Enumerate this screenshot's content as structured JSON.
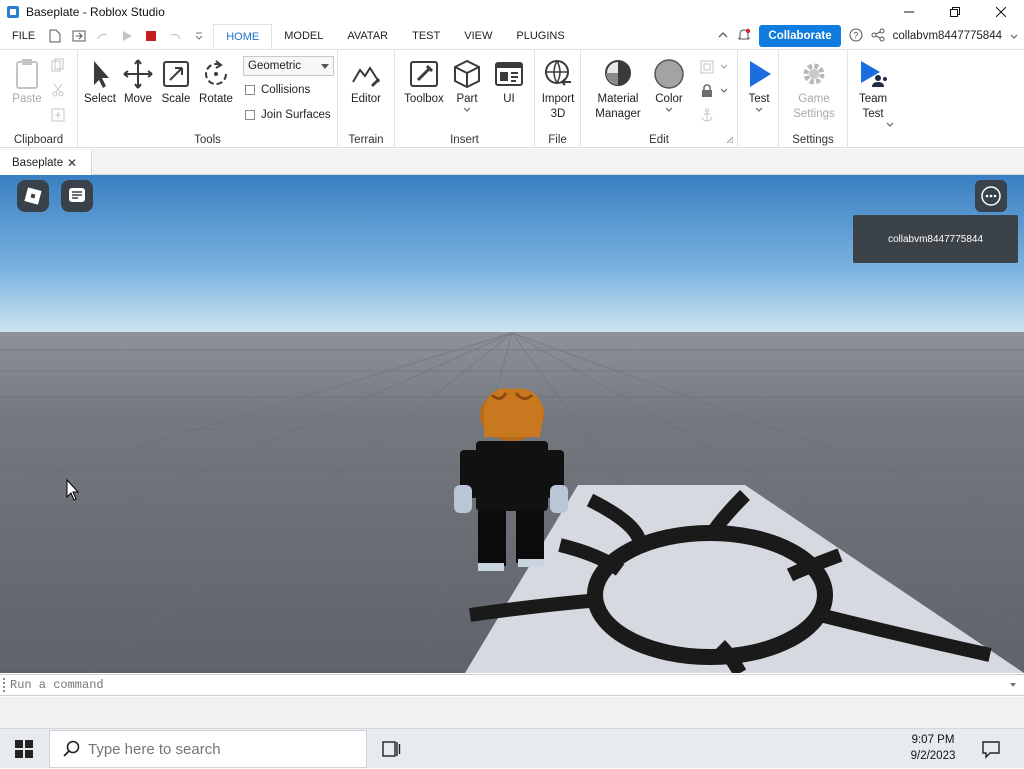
{
  "window": {
    "title": "Baseplate - Roblox Studio"
  },
  "menu": {
    "file": "FILE",
    "tabs": [
      "HOME",
      "MODEL",
      "AVATAR",
      "TEST",
      "VIEW",
      "PLUGINS"
    ],
    "active_tab": "HOME",
    "collaborate": "Collaborate",
    "username": "collabvm8447775844"
  },
  "ribbon": {
    "clipboard": {
      "paste": "Paste",
      "group": "Clipboard"
    },
    "tools": {
      "select": "Select",
      "move": "Move",
      "scale": "Scale",
      "rotate": "Rotate",
      "mode": "Geometric",
      "collisions": "Collisions",
      "join_surfaces": "Join Surfaces",
      "group": "Tools"
    },
    "terrain": {
      "editor": "Editor",
      "group": "Terrain"
    },
    "insert": {
      "toolbox": "Toolbox",
      "part": "Part",
      "ui": "UI",
      "group": "Insert"
    },
    "file": {
      "import_line1": "Import",
      "import_line2": "3D",
      "group": "File"
    },
    "edit": {
      "material_line1": "Material",
      "material_line2": "Manager",
      "color": "Color",
      "group": "Edit"
    },
    "test": {
      "test": "Test"
    },
    "settings": {
      "game_line1": "Game",
      "game_line2": "Settings",
      "group": "Settings"
    },
    "team_test": {
      "line1": "Team",
      "line2": "Test"
    }
  },
  "document_tab": {
    "label": "Baseplate",
    "close": "✕"
  },
  "viewport": {
    "player_name": "collabvm8447775844"
  },
  "command_bar": {
    "placeholder": "Run a command"
  },
  "taskbar": {
    "search_placeholder": "Type here to search",
    "time": "9:07 PM",
    "date": "9/2/2023"
  },
  "colors": {
    "accent": "#0f7ce0",
    "active_tab": "#1e6fc7",
    "test_play": "#1b6ee0",
    "stop": "#c41e1e"
  }
}
